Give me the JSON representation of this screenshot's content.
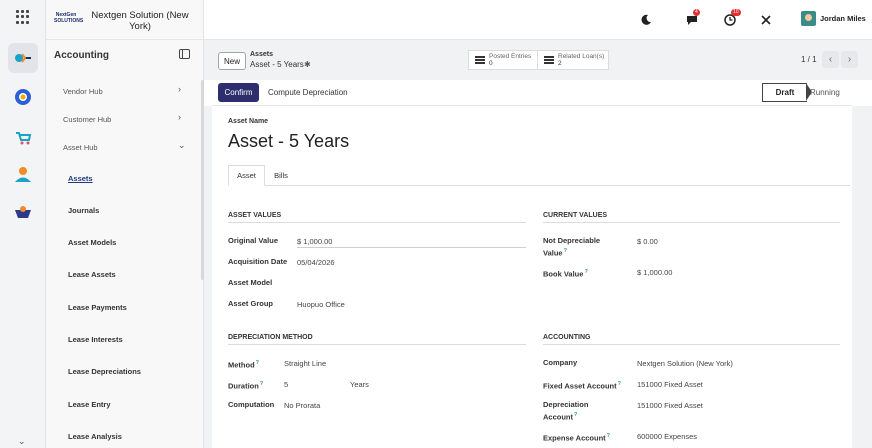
{
  "app_icons": [
    "apps-grid-icon",
    "accounting-app-icon",
    "discuss-app-icon",
    "sales-app-icon",
    "contacts-app-icon",
    "inventory-app-icon"
  ],
  "brand": {
    "logo_text": "NextGen SOLUTIONS",
    "company": "Nextgen Solution (New York)"
  },
  "sidebar": {
    "title": "Accounting",
    "groups": [
      {
        "label": "Vendor Hub"
      },
      {
        "label": "Customer Hub"
      },
      {
        "label": "Asset Hub"
      }
    ],
    "items": [
      {
        "label": "Assets"
      },
      {
        "label": "Journals"
      },
      {
        "label": "Asset Models"
      },
      {
        "label": "Lease Assets"
      },
      {
        "label": "Lease Payments"
      },
      {
        "label": "Lease Interests"
      },
      {
        "label": "Lease Depreciations"
      },
      {
        "label": "Lease Entry"
      },
      {
        "label": "Lease Analysis"
      }
    ]
  },
  "topnav": {
    "messages_badge": "4",
    "activities_badge": "10",
    "user_name": "Jordan Miles"
  },
  "control": {
    "new_label": "New",
    "breadcrumb_parent": "Assets",
    "breadcrumb_current": "Asset - 5 Years",
    "smart_buttons": [
      {
        "label": "Posted Entries",
        "value": "0"
      },
      {
        "label": "Related Loan(s)",
        "value": "2"
      }
    ],
    "pager": "1 / 1"
  },
  "statusbar": {
    "confirm_label": "Confirm",
    "compute_label": "Compute Depreciation",
    "stages": [
      "Draft",
      "Running"
    ],
    "current_stage": "Draft"
  },
  "form": {
    "name_label": "Asset Name",
    "name": "Asset - 5 Years",
    "tabs": [
      "Asset",
      "Bills"
    ],
    "asset_values": {
      "title": "ASSET VALUES",
      "original_value_label": "Original Value",
      "original_value": "$ 1,000.00",
      "acquisition_date_label": "Acquisition Date",
      "acquisition_date": "05/04/2026",
      "asset_model_label": "Asset Model",
      "asset_model": "",
      "asset_group_label": "Asset Group",
      "asset_group": "Huopuo Office"
    },
    "current_values": {
      "title": "CURRENT VALUES",
      "not_depreciable_label_1": "Not Depreciable",
      "not_depreciable_label_2": "Value",
      "not_depreciable": "$ 0.00",
      "book_value_label": "Book Value",
      "book_value": "$ 1,000.00"
    },
    "depreciation": {
      "title": "DEPRECIATION METHOD",
      "method_label": "Method",
      "method": "Straight Line",
      "duration_label": "Duration",
      "duration": "5",
      "duration_unit": "Years",
      "computation_label": "Computation",
      "computation": "No Prorata"
    },
    "accounting": {
      "title": "ACCOUNTING",
      "company_label": "Company",
      "company": "Nextgen Solution (New York)",
      "fixed_asset_account_label": "Fixed Asset Account",
      "fixed_asset_account": "151000 Fixed Asset",
      "depreciation_account_label_1": "Depreciation",
      "depreciation_account_label_2": "Account",
      "depreciation_account": "151000 Fixed Asset",
      "expense_account_label": "Expense Account",
      "expense_account": "600000 Expenses"
    }
  }
}
